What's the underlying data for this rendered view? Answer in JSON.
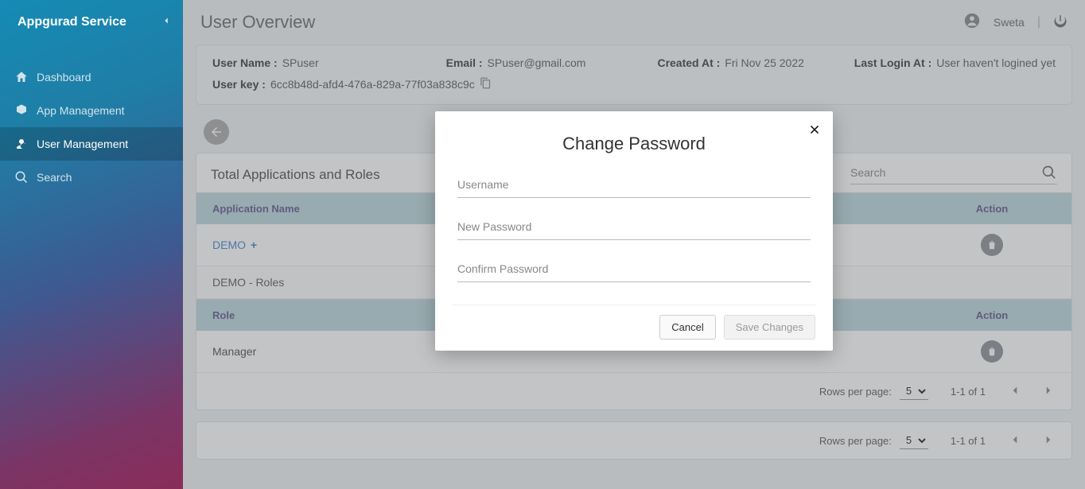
{
  "brand": "Appgurad Service",
  "sidebar": {
    "items": [
      {
        "label": "Dashboard"
      },
      {
        "label": "App Management"
      },
      {
        "label": "User Management"
      },
      {
        "label": "Search"
      }
    ]
  },
  "header": {
    "page_title": "User Overview",
    "user_name": "Sweta"
  },
  "info": {
    "user_name_label": "User Name :",
    "user_name_value": "SPuser",
    "email_label": "Email :",
    "email_value": "SPuser@gmail.com",
    "created_at_label": "Created At :",
    "created_at_value": "Fri Nov 25 2022",
    "last_login_label": "Last Login At :",
    "last_login_value": "User haven't logined yet",
    "user_key_label": "User key :",
    "user_key_value": "6cc8b48d-afd4-476a-829a-77f03a838c9c"
  },
  "applications": {
    "section_title": "Total Applications and Roles",
    "search_placeholder": "Search",
    "col_app": "Application Name",
    "col_action": "Action",
    "rows": [
      {
        "name": "DEMO"
      }
    ],
    "roles_header_prefix": "DEMO - Roles",
    "col_role": "Role",
    "role_rows": [
      {
        "name": "Manager"
      }
    ]
  },
  "pagination": {
    "rows_per_page_label": "Rows per page:",
    "rows_per_page_value": "5",
    "range": "1-1 of 1"
  },
  "modal": {
    "title": "Change Password",
    "username_placeholder": "Username",
    "new_password_placeholder": "New Password",
    "confirm_password_placeholder": "Confirm Password",
    "cancel_label": "Cancel",
    "save_label": "Save Changes"
  }
}
